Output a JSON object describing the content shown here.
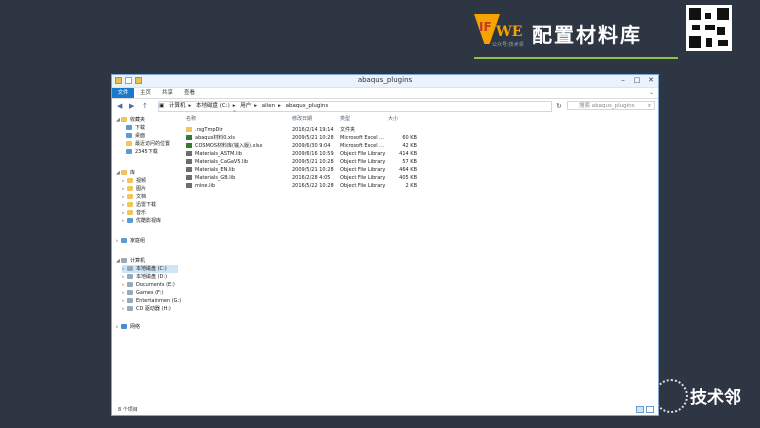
{
  "brand": {
    "logo_if": "IF",
    "logo_we": "WE",
    "logo_sub": "公众号:技术邻",
    "title": "配置材料库"
  },
  "watermark": {
    "text": "技术邻"
  },
  "window": {
    "title": "abaqus_plugins",
    "controls": {
      "minimize": "–",
      "maximize": "□",
      "close": "✕"
    },
    "ribbon_tabs": [
      "文件",
      "主页",
      "共享",
      "查看"
    ],
    "ribbon_expand": "⌄",
    "address": {
      "back": "◀",
      "forward": "▶",
      "up": "↑",
      "crumbs": [
        "计算机",
        "本地磁盘 (C:)",
        "用户",
        "alien",
        "abaqus_plugins"
      ]
    },
    "refresh": "↻",
    "search_placeholder": "搜索 abaqus_plugins"
  },
  "navigation": {
    "favorites": {
      "label": "收藏夹",
      "items": [
        "下载",
        "桌面",
        "最近访问的位置",
        "2345下载"
      ]
    },
    "libraries": {
      "label": "库",
      "items": [
        "视频",
        "图片",
        "文档",
        "迅雷下载",
        "音乐",
        "优酷影视库"
      ]
    },
    "homegroup": "家庭组",
    "computer": {
      "label": "计算机",
      "items": [
        "本地磁盘 (C:)",
        "本地磁盘 (D:)",
        "Documents (E:)",
        "Games (F:)",
        "Entertainmen (G:)",
        "CD 驱动器 (H:)"
      ],
      "selected_index": 0
    },
    "network": "网络"
  },
  "file_list": {
    "columns": {
      "name": "名称",
      "date": "修改日期",
      "type": "类型",
      "size": "大小"
    },
    "sort_indicator": "^",
    "rows": [
      {
        "name": ".rsgTmpDir",
        "date": "2016/2/14 19:14",
        "type": "文件夹",
        "size": "",
        "icon": "folder-icon"
      },
      {
        "name": "abaqus材料0.xls",
        "date": "2009/5/21 10:28",
        "type": "Microsoft Excel ...",
        "size": "60 KB",
        "icon": "excel-icon"
      },
      {
        "name": "COSMOS材料库(输入版).xlsx",
        "date": "2009/6/30 9:04",
        "type": "Microsoft Excel ...",
        "size": "42 KB",
        "icon": "excel-icon"
      },
      {
        "name": "Materials_ASTM.lib",
        "date": "2009/6/16 10:59",
        "type": "Object File Library",
        "size": "414 KB",
        "icon": "library-icon"
      },
      {
        "name": "Materials_CaGaV5.lib",
        "date": "2009/5/21 10:28",
        "type": "Object File Library",
        "size": "57 KB",
        "icon": "library-icon"
      },
      {
        "name": "Materials_EN.lib",
        "date": "2009/5/21 10:28",
        "type": "Object File Library",
        "size": "464 KB",
        "icon": "library-icon"
      },
      {
        "name": "Materials_GB.lib",
        "date": "2016/2/28 4:05",
        "type": "Object File Library",
        "size": "405 KB",
        "icon": "library-icon"
      },
      {
        "name": "mine.lib",
        "date": "2016/5/22 10:28",
        "type": "Object File Library",
        "size": "2 KB",
        "icon": "library-icon"
      }
    ]
  },
  "status": {
    "text": "8 个项目"
  }
}
